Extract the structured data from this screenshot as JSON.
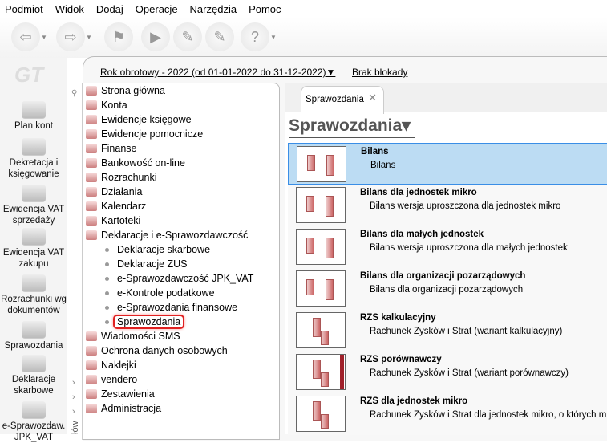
{
  "menu": [
    "Podmiot",
    "Widok",
    "Dodaj",
    "Operacje",
    "Narzędzia",
    "Pomoc"
  ],
  "toolbar": [
    "back-icon",
    "forward-icon",
    "home-flag-icon",
    "run-icon",
    "edit-icon",
    "edit-disabled-icon",
    "help-icon"
  ],
  "logo": "GT",
  "header": {
    "year": "Rok obrotowy - 2022  (od 01-01-2022 do 31-12-2022)▼",
    "lock": "Brak blokady"
  },
  "shortcuts": [
    "Plan kont",
    "Dekretacja i księgowanie",
    "Ewidencja VAT sprzedaży",
    "Ewidencja VAT zakupu",
    "Rozrachunki wg dokumentów",
    "Sprawozdania",
    "Deklaracje skarbowe",
    "e-Sprawozdaw. JPK_VAT"
  ],
  "tree": {
    "items": [
      "Strona główna",
      "Konta",
      "Ewidencje księgowe",
      "Ewidencje pomocnicze",
      "Finanse",
      "Bankowość on-line",
      "Rozrachunki",
      "Działania",
      "Kalendarz",
      "Kartoteki",
      "Deklaracje i e-Sprawozdawczość"
    ],
    "sub": [
      "Deklaracje skarbowe",
      "Deklaracje ZUS",
      "e-Sprawozdawczość JPK_VAT",
      "e-Kontrole podatkowe",
      "e-Sprawozdania finansowe",
      "Sprawozdania"
    ],
    "after": [
      "Wiadomości SMS",
      "Ochrona danych osobowych",
      "Naklejki",
      "vendero",
      "Zestawienia",
      "Administracja"
    ],
    "strip_label": "łów"
  },
  "tab": {
    "label": "Sprawozdania",
    "close": "✕"
  },
  "page_title": "Sprawozdania▾",
  "reports": [
    {
      "title": "Bilans",
      "desc": "Bilans"
    },
    {
      "title": "Bilans dla jednostek mikro",
      "desc": "Bilans wersja uproszczona dla jednostek mikro"
    },
    {
      "title": "Bilans dla małych jednostek",
      "desc": "Bilans wersja uproszczona dla małych jednostek"
    },
    {
      "title": "Bilans dla organizacji pozarządowych",
      "desc": "Bilans dla organizacji pozarządowych"
    },
    {
      "title": "RZS kalkulacyjny",
      "desc": "Rachunek Zysków i Strat (wariant kalkulacyjny)"
    },
    {
      "title": "RZS porównawczy",
      "desc": "Rachunek Zysków i Strat (wariant porównawczy)"
    },
    {
      "title": "RZS dla jednostek mikro",
      "desc": "Rachunek Zysków i Strat dla jednostek mikro, o których m"
    }
  ]
}
